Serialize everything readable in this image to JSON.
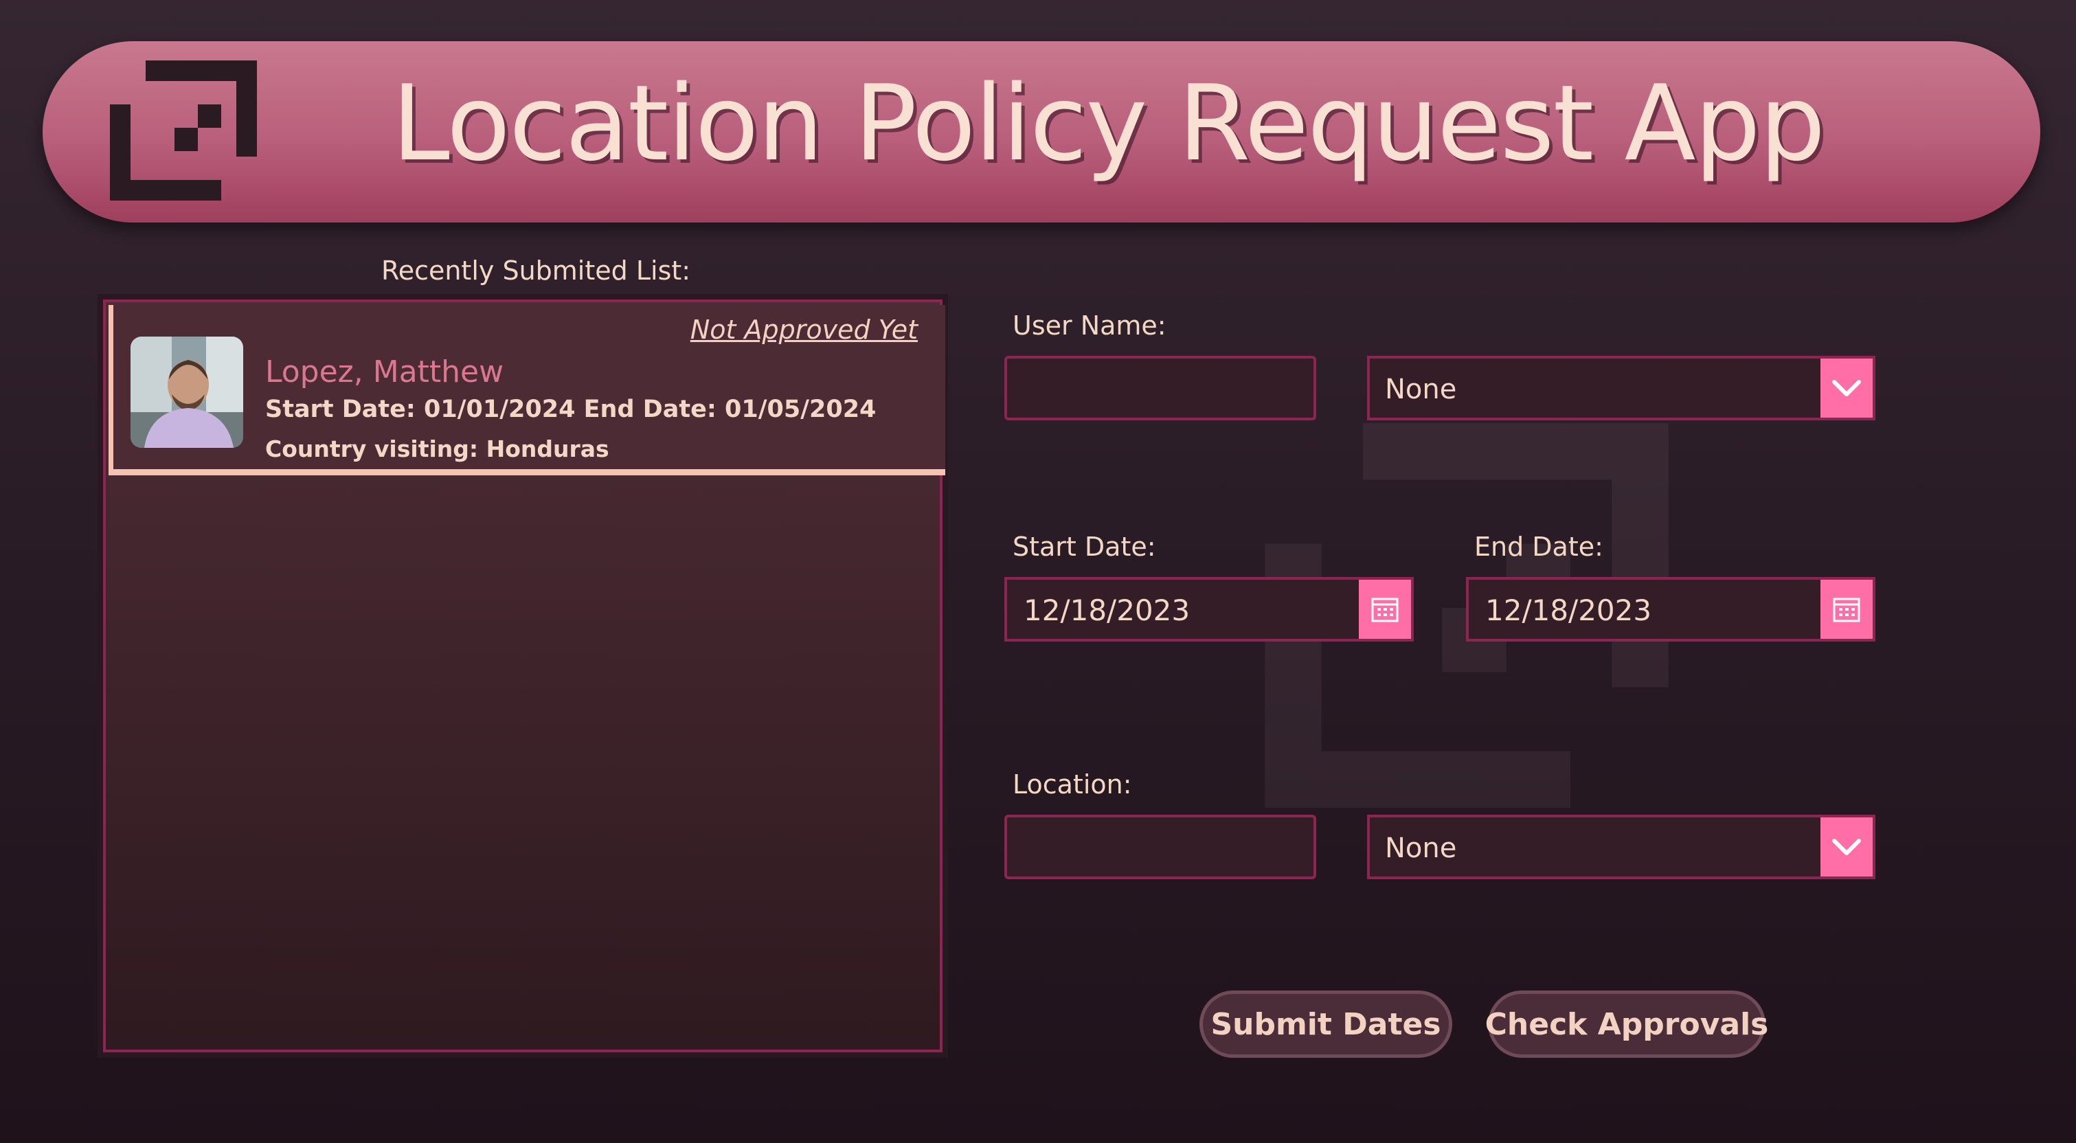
{
  "header": {
    "title": "Location Policy Request App",
    "logo_icon": "app-logo-icon"
  },
  "recent_list": {
    "label": "Recently Submited List:",
    "items": [
      {
        "status": "Not Approved Yet",
        "name": "Lopez, Matthew",
        "dates": "Start Date: 01/01/2024 End Date: 01/05/2024",
        "country": "Country visiting: Honduras",
        "avatar_icon": "user-photo"
      }
    ]
  },
  "form": {
    "user_name": {
      "label": "User Name:",
      "input_value": "",
      "dropdown_value": "None"
    },
    "start_date": {
      "label": "Start Date:",
      "value": "12/18/2023"
    },
    "end_date": {
      "label": "End Date:",
      "value": "12/18/2023"
    },
    "location": {
      "label": "Location:",
      "input_value": "",
      "dropdown_value": "None"
    }
  },
  "actions": {
    "submit_label": "Submit Dates",
    "check_label": "Check Approvals"
  },
  "colors": {
    "accent": "#ff6ea7",
    "header_pink": "#b95f7b",
    "border": "#8d2553",
    "text_light": "#f4d8c6"
  }
}
